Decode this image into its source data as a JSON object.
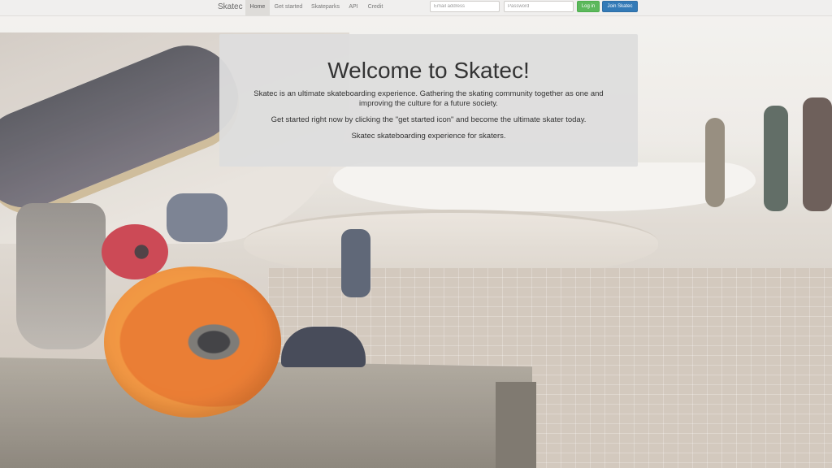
{
  "navbar": {
    "brand": "Skatec",
    "items": [
      {
        "label": "Home",
        "active": true
      },
      {
        "label": "Get started",
        "active": false
      },
      {
        "label": "Skateparks",
        "active": false
      },
      {
        "label": "API",
        "active": false
      },
      {
        "label": "Credit",
        "active": false
      }
    ],
    "email_placeholder": "Email address",
    "password_placeholder": "Password",
    "login_label": "Log in",
    "join_label": "Join Skatec"
  },
  "jumbotron": {
    "title": "Welcome to Skatec!",
    "paragraphs": [
      "Skatec is an ultimate skateboarding experience. Gathering the skating community together as one and improving the culture for a future society.",
      "Get started right now by clicking the \"get started icon\" and become the ultimate skater today.",
      "Skatec skateboarding experience for skaters."
    ]
  },
  "colors": {
    "login_button": "#5cb85c",
    "join_button": "#337ab7",
    "navbar_bg": "#f0efee",
    "jumbotron_bg": "#dddddd"
  }
}
